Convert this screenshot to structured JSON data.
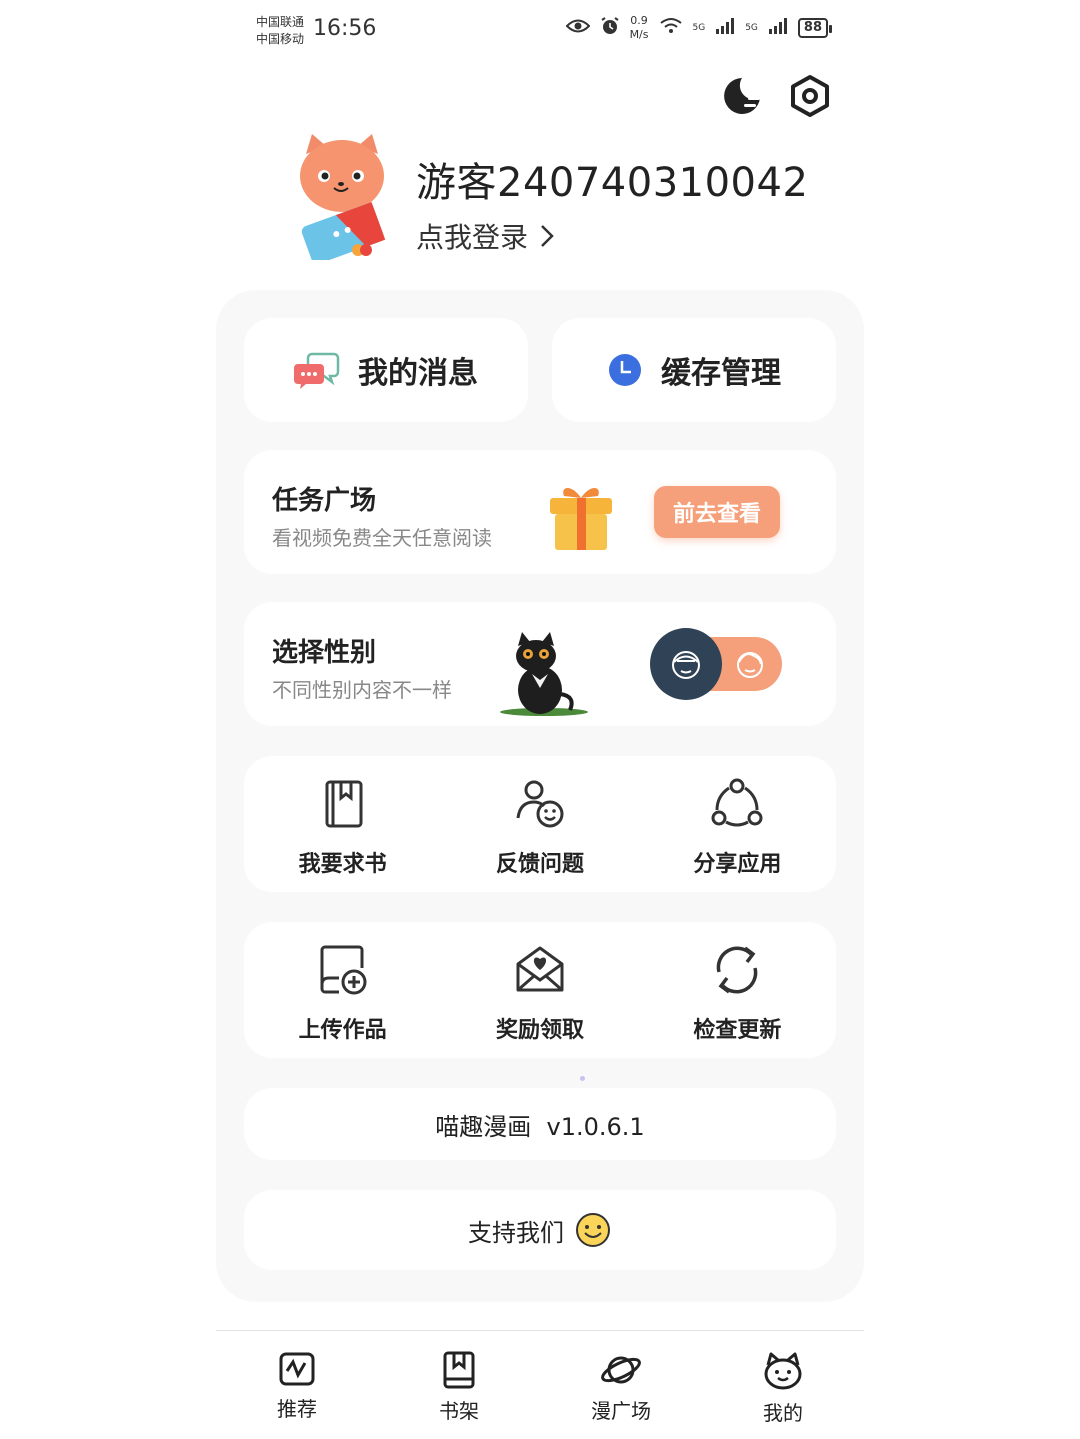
{
  "status_bar": {
    "carrier1": "中国联通",
    "carrier2": "中国移动",
    "time": "16:56",
    "net_speed_value": "0.9",
    "net_speed_unit": "M/s",
    "signal1": "5G",
    "signal2": "5G",
    "battery": "88"
  },
  "header": {
    "username": "游客240740310042",
    "login_label": "点我登录"
  },
  "quick_actions": {
    "messages_label": "我的消息",
    "cache_label": "缓存管理"
  },
  "task_card": {
    "title": "任务广场",
    "subtitle": "看视频免费全天任意阅读",
    "button_label": "前去查看"
  },
  "gender_card": {
    "title": "选择性别",
    "subtitle": "不同性别内容不一样"
  },
  "grid_row_1": [
    {
      "label": "我要求书",
      "icon": "book-request-icon"
    },
    {
      "label": "反馈问题",
      "icon": "feedback-icon"
    },
    {
      "label": "分享应用",
      "icon": "share-icon"
    }
  ],
  "grid_row_2": [
    {
      "label": "上传作品",
      "icon": "upload-icon"
    },
    {
      "label": "奖励领取",
      "icon": "reward-mail-icon"
    },
    {
      "label": "检查更新",
      "icon": "refresh-icon"
    }
  ],
  "version_text": "喵趣漫画  v1.0.6.1",
  "support_text": "支持我们",
  "tabbar": [
    {
      "label": "推荐",
      "icon": "recommend-icon"
    },
    {
      "label": "书架",
      "icon": "bookshelf-icon"
    },
    {
      "label": "漫广场",
      "icon": "planet-icon"
    },
    {
      "label": "我的",
      "icon": "cat-face-icon"
    }
  ],
  "colors": {
    "accent": "#f5a07a",
    "panel_bg": "#f8f8f9",
    "toggle_knob": "#2f4256",
    "cache_icon": "#3b6fe0"
  }
}
